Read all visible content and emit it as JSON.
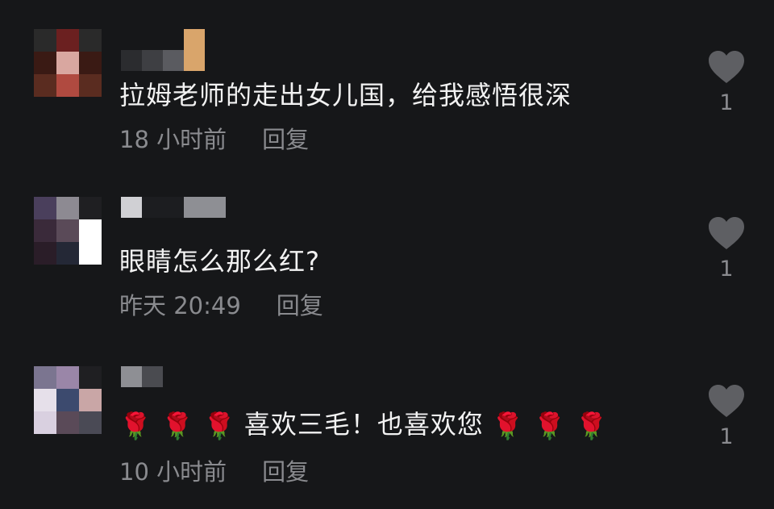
{
  "comments": [
    {
      "text": "拉姆老师的走出女儿国，给我感悟很深",
      "time": "18 小时前",
      "reply_label": "回复",
      "likes": "1",
      "avatar_colors": [
        "#2a2a2a",
        "#6b2020",
        "#2a2a2a",
        "#3a1a14",
        "#d9a7a0",
        "#3a1a14",
        "#5a2c20",
        "#b04a40",
        "#5a2c20"
      ]
    },
    {
      "text": "眼睛怎么那么红?",
      "time": "昨天 20:49",
      "reply_label": "回复",
      "likes": "1",
      "avatar_colors": [
        "#4a3f5c",
        "#8d8a92",
        "#1f1f22",
        "#3a2a3a",
        "#5a4a58",
        "#ffffff",
        "#2a1d28",
        "#242836",
        "#ffffff"
      ]
    },
    {
      "text_roses_before": "🌹 🌹 🌹",
      "text": "喜欢三毛！也喜欢您",
      "text_roses_after": "🌹 🌹 🌹",
      "time": "10 小时前",
      "reply_label": "回复",
      "likes": "1",
      "avatar_colors": [
        "#7b7590",
        "#9a86a8",
        "#1f1f22",
        "#e6e0ea",
        "#3c4a6e",
        "#c9a6a6",
        "#d9d0e0",
        "#5a4a58",
        "#4a4a55"
      ]
    }
  ],
  "colors": {
    "background": "#161719",
    "text": "#f2f2f2",
    "meta": "#8a8b8f",
    "heart": "#5e5f63"
  },
  "icons": [
    "heart-icon"
  ]
}
